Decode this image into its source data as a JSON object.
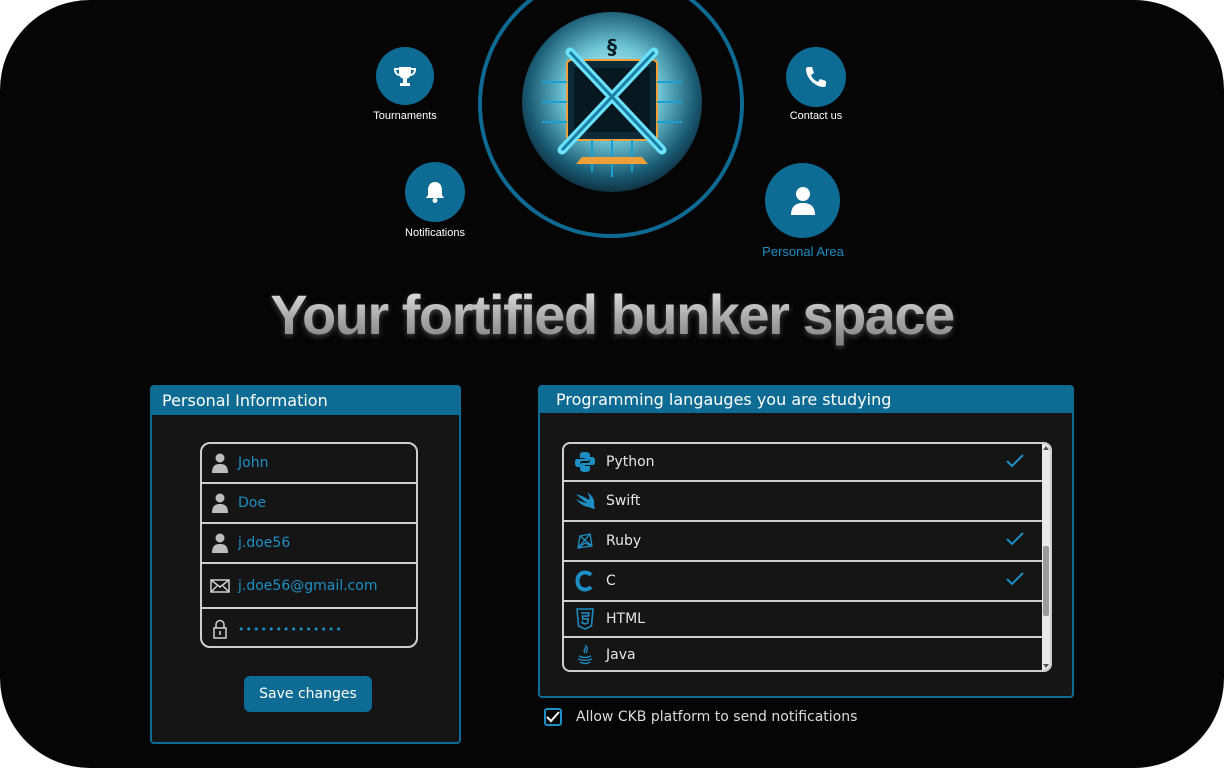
{
  "nav": {
    "tournaments": "Tournaments",
    "notifications": "Notifications",
    "contact": "Contact us",
    "personal_area": "Personal Area"
  },
  "headline": "Your fortified bunker space",
  "personal": {
    "title": "Personal Information",
    "first_name": "John",
    "last_name": "Doe",
    "username": "j.doe56",
    "email": "j.doe56@gmail.com",
    "password": "••••••••••••••",
    "save_label": "Save changes"
  },
  "languages": {
    "title": "Programming langauges you are studying",
    "items": [
      {
        "name": "Python",
        "checked": true,
        "icon": "python-icon"
      },
      {
        "name": "Swift",
        "checked": false,
        "icon": "swift-icon"
      },
      {
        "name": "Ruby",
        "checked": true,
        "icon": "ruby-icon"
      },
      {
        "name": "C",
        "checked": true,
        "icon": "c-icon"
      },
      {
        "name": "HTML",
        "checked": false,
        "icon": "html5-icon"
      },
      {
        "name": "Java",
        "checked": false,
        "icon": "java-icon"
      }
    ]
  },
  "notify": {
    "label": "Allow CKB platform to send notifications",
    "checked": true
  },
  "colors": {
    "accent": "#0d6b94",
    "field_text": "#1e8fc4",
    "background": "#050505"
  }
}
